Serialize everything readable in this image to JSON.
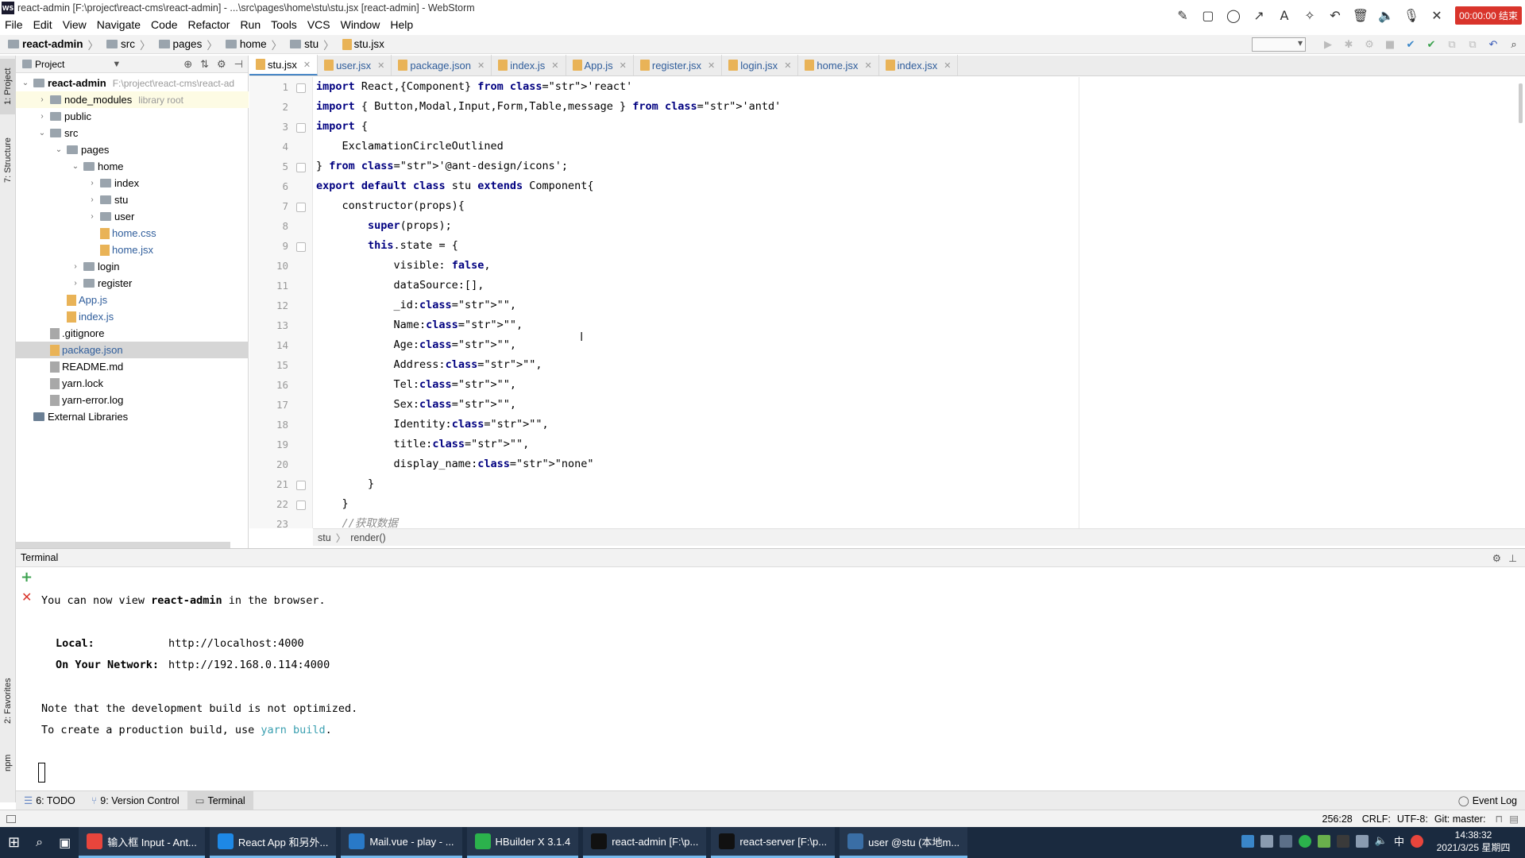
{
  "window": {
    "title": "react-admin [F:\\project\\react-cms\\react-admin] - ...\\src\\pages\\home\\stu\\stu.jsx [react-admin] - WebStorm",
    "logo": "WS"
  },
  "recorder": {
    "time": "00:00:00 结束"
  },
  "menu": [
    "File",
    "Edit",
    "View",
    "Navigate",
    "Code",
    "Refactor",
    "Run",
    "Tools",
    "VCS",
    "Window",
    "Help"
  ],
  "breadcrumb": [
    "react-admin",
    "src",
    "pages",
    "home",
    "stu",
    "stu.jsx"
  ],
  "project_panel": {
    "title": "Project",
    "tree": [
      {
        "label": "react-admin",
        "hint": "F:\\project\\react-cms\\react-ad",
        "depth": 0,
        "kind": "folder",
        "expanded": true,
        "bold": true
      },
      {
        "label": "node_modules",
        "hint": "library root",
        "depth": 1,
        "kind": "folder",
        "expanded": false,
        "highlight": true
      },
      {
        "label": "public",
        "hint": "",
        "depth": 1,
        "kind": "folder",
        "expanded": false
      },
      {
        "label": "src",
        "hint": "",
        "depth": 1,
        "kind": "folder",
        "expanded": true
      },
      {
        "label": "pages",
        "hint": "",
        "depth": 2,
        "kind": "folder",
        "expanded": true
      },
      {
        "label": "home",
        "hint": "",
        "depth": 3,
        "kind": "folder",
        "expanded": true
      },
      {
        "label": "index",
        "hint": "",
        "depth": 4,
        "kind": "folder",
        "expanded": false
      },
      {
        "label": "stu",
        "hint": "",
        "depth": 4,
        "kind": "folder",
        "expanded": false
      },
      {
        "label": "user",
        "hint": "",
        "depth": 4,
        "kind": "folder",
        "expanded": false
      },
      {
        "label": "home.css",
        "hint": "",
        "depth": 4,
        "kind": "file",
        "color": "#2f5d9b"
      },
      {
        "label": "home.jsx",
        "hint": "",
        "depth": 4,
        "kind": "file",
        "color": "#2f5d9b"
      },
      {
        "label": "login",
        "hint": "",
        "depth": 3,
        "kind": "folder",
        "expanded": false
      },
      {
        "label": "register",
        "hint": "",
        "depth": 3,
        "kind": "folder",
        "expanded": false
      },
      {
        "label": "App.js",
        "hint": "",
        "depth": 2,
        "kind": "file",
        "color": "#2f5d9b"
      },
      {
        "label": "index.js",
        "hint": "",
        "depth": 2,
        "kind": "file",
        "color": "#2f5d9b"
      },
      {
        "label": ".gitignore",
        "hint": "",
        "depth": 1,
        "kind": "file",
        "color": "#000"
      },
      {
        "label": "package.json",
        "hint": "",
        "depth": 1,
        "kind": "file",
        "color": "#2f5d9b",
        "selected": true
      },
      {
        "label": "README.md",
        "hint": "",
        "depth": 1,
        "kind": "file",
        "color": "#000"
      },
      {
        "label": "yarn.lock",
        "hint": "",
        "depth": 1,
        "kind": "file",
        "color": "#000"
      },
      {
        "label": "yarn-error.log",
        "hint": "",
        "depth": 1,
        "kind": "file",
        "color": "#000"
      },
      {
        "label": "External Libraries",
        "hint": "",
        "depth": 0,
        "kind": "lib"
      }
    ]
  },
  "editor_tabs": [
    "stu.jsx",
    "user.jsx",
    "package.json",
    "index.js",
    "App.js",
    "register.jsx",
    "login.jsx",
    "home.jsx",
    "index.jsx"
  ],
  "code_lines": [
    "import React,{Component} from 'react'",
    "import { Button,Modal,Input,Form,Table,message } from 'antd'",
    "import {",
    "    ExclamationCircleOutlined",
    "} from '@ant-design/icons';",
    "export default class stu extends Component{",
    "    constructor(props){",
    "        super(props);",
    "        this.state = {",
    "            visible: false,",
    "            dataSource:[],",
    "            _id:\"\",",
    "            Name:\"\",",
    "            Age:\"\",",
    "            Address:\"\",",
    "            Tel:\"\",",
    "            Sex:\"\",",
    "            Identity:\"\",",
    "            title:\"\",",
    "            display_name:\"none\"",
    "        }",
    "    }",
    "    //获取数据"
  ],
  "code_breadcrumb": [
    "stu",
    "render()"
  ],
  "terminal": {
    "title": "Terminal",
    "l1a": "You can now view ",
    "l1b": "react-admin",
    "l1c": " in the browser.",
    "local_label": "Local:",
    "local_url": "http://localhost:4000",
    "net_label": "On Your Network:",
    "net_url": "http://192.168.0.114:4000",
    "note": "Note that the development build is not optimized.",
    "prod_a": "To create a production build, use ",
    "prod_b": "yarn build",
    "prod_c": "."
  },
  "bottom_tabs": {
    "todo": "6: TODO",
    "vcs": "9: Version Control",
    "terminal": "Terminal",
    "event_log": "Event Log"
  },
  "side_tabs": {
    "project": "1: Project",
    "structure": "7: Structure",
    "favorites": "2: Favorites",
    "npm": "npm"
  },
  "status": {
    "pos": "256:28",
    "eol": "CRLF",
    "enc": "UTF-8",
    "git": "Git: master"
  },
  "taskbar": {
    "items": [
      {
        "label": "输入框 Input - Ant...",
        "color": "#e8453c"
      },
      {
        "label": "React App 和另外...",
        "color": "#1e88e5"
      },
      {
        "label": "Mail.vue - play - ...",
        "color": "#2979c7"
      },
      {
        "label": "HBuilder X 3.1.4",
        "color": "#2bb24c"
      },
      {
        "label": "react-admin [F:\\p...",
        "color": "#111"
      },
      {
        "label": "react-server [F:\\p...",
        "color": "#111"
      },
      {
        "label": "user @stu (本地m...",
        "color": "#3a6ea5"
      }
    ],
    "ime": "中",
    "time": "14:38:32",
    "date": "2021/3/25 星期四"
  }
}
